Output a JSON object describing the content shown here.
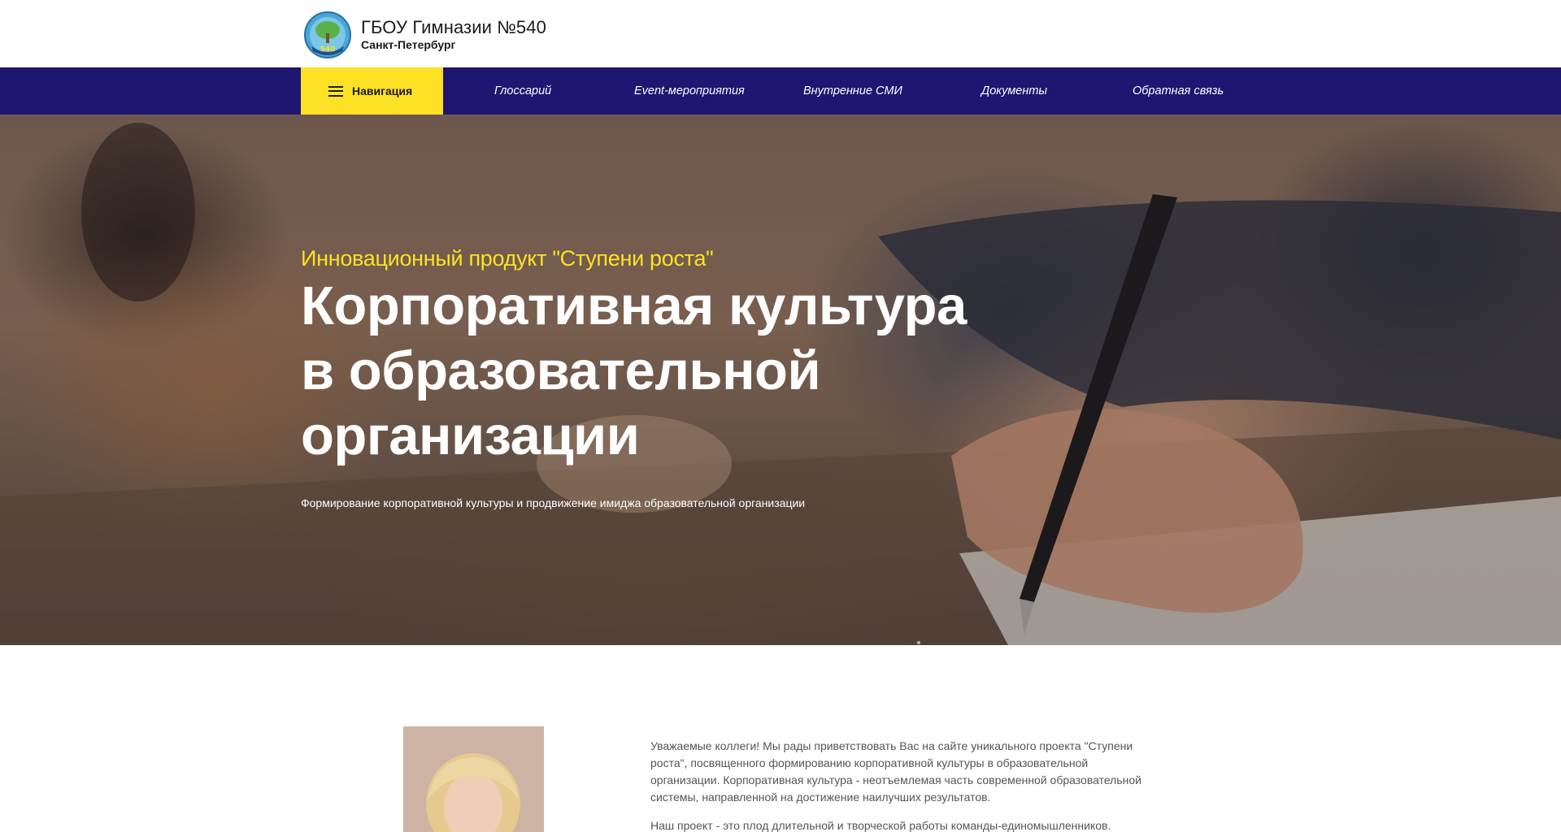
{
  "header": {
    "title": "ГБОУ Гимназии №540",
    "city": "Санкт-Петербург",
    "logo_text": "Гимназия №540"
  },
  "nav": {
    "toggle_label": "Навигация",
    "links": [
      "Глоссарий",
      "Event-мероприятия",
      "Внутренние СМИ",
      "Документы",
      "Обратная связь"
    ]
  },
  "hero": {
    "subtitle": "Инновационный продукт \"Ступени роста\"",
    "title_line1": "Корпоративная культура",
    "title_line2": "в образовательной",
    "title_line3": "организации",
    "description": "Формирование корпоративной культуры и продвижение имиджа образовательной организации"
  },
  "intro": {
    "paragraph1": "Уважаемые коллеги! Мы рады приветствовать Вас на сайте уникального проекта \"Ступени роста\", посвященного формированию корпоративной культуры в образовательной организации. Корпоративная культура - неотъемлемая часть современной образовательной системы, направленной на достижение наилучших результатов.",
    "paragraph2": "Наш проект - это плод длительной и творческой работы команды-единомышленников."
  },
  "colors": {
    "nav_bg": "#1e1670",
    "accent": "#fde124",
    "text_dark": "#1b1b1b"
  }
}
